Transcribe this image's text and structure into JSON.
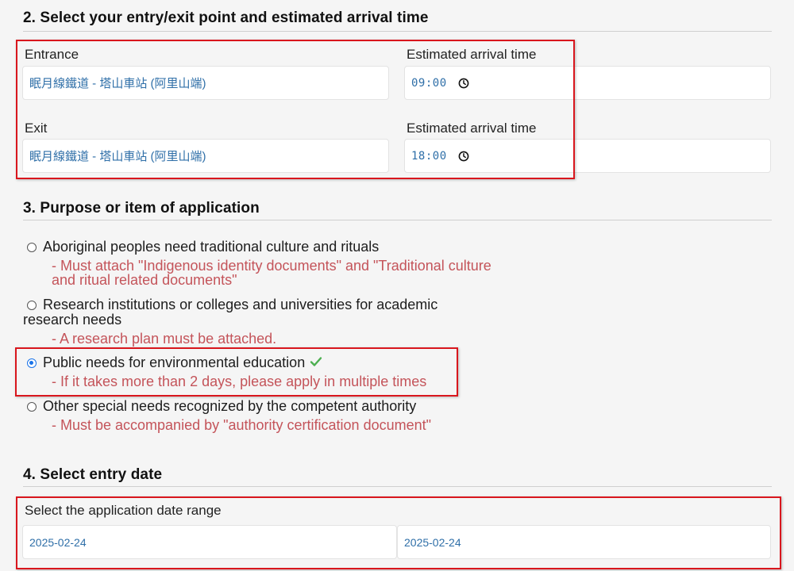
{
  "section2": {
    "title": "2. Select your entry/exit point and estimated arrival time",
    "entrance_label": "Entrance",
    "entrance_value": "眠月線鐵道 - 塔山車站 (阿里山端)",
    "entrance_time_label": "Estimated arrival time",
    "entrance_time_value": "09:00",
    "exit_label": "Exit",
    "exit_value": "眠月線鐵道 - 塔山車站 (阿里山端)",
    "exit_time_label": "Estimated arrival time",
    "exit_time_value": "18:00"
  },
  "section3": {
    "title": "3. Purpose or item of application",
    "options": [
      {
        "label": "Aboriginal peoples need traditional culture and rituals",
        "note": "- Must attach \"Indigenous identity documents\" and \"Traditional culture and ritual related documents\"",
        "checked": false
      },
      {
        "label": "Research institutions or colleges and universities for academic research needs",
        "note": "- A research plan must be attached.",
        "checked": false
      },
      {
        "label": "Public needs for environmental education",
        "note": "- If it takes more than 2 days, please apply in multiple times",
        "checked": true
      },
      {
        "label": "Other special needs recognized by the competent authority",
        "note": "- Must be accompanied by \"authority certification document\"",
        "checked": false
      }
    ]
  },
  "section4": {
    "title": "4. Select entry date",
    "range_label": "Select the application date range",
    "start_date": "2025-02-24",
    "end_date": "2025-02-24"
  },
  "icons": {
    "clock": "clock-icon",
    "check": "check-icon",
    "check_color": "#4caf50",
    "highlight_color": "#d9161d",
    "note_color": "#c4545a"
  }
}
